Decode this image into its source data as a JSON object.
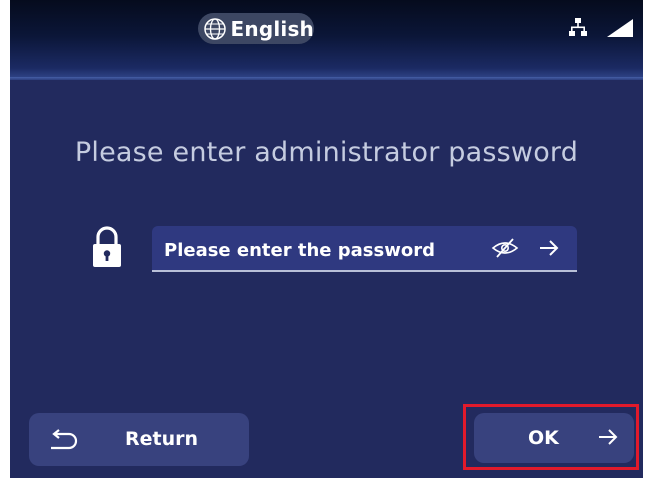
{
  "header": {
    "language_label": "English",
    "language_icon": "globe-icon",
    "network_icon": "network-icon",
    "signal_icon": "signal-icon"
  },
  "main": {
    "title": "Please enter administrator password",
    "password_field": {
      "placeholder": "Please enter the password",
      "lock_icon": "lock-icon",
      "visibility_icon": "eye-off-icon",
      "submit_icon": "arrow-right-icon"
    }
  },
  "footer": {
    "return_label": "Return",
    "return_icon": "return-arrow-icon",
    "ok_label": "OK",
    "ok_icon": "arrow-right-icon"
  },
  "colors": {
    "background": "#222a5e",
    "button": "#38427e",
    "field": "#2f3980",
    "highlight": "#e11a2b",
    "title_text": "#c5cce0"
  }
}
